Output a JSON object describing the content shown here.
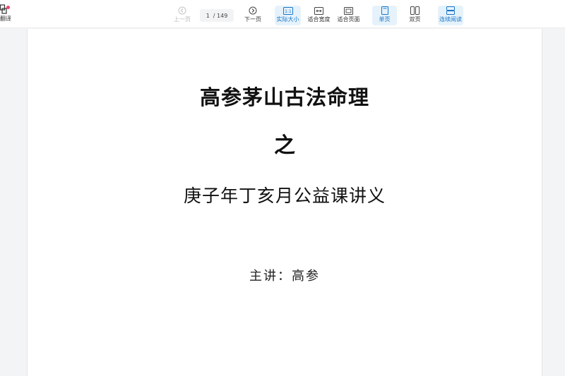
{
  "toolbar": {
    "translate_label": "翻译",
    "prev_label": "上一页",
    "next_label": "下一页",
    "current_page": "1",
    "total_pages": "/ 149",
    "actual_size_label": "实际大小",
    "fit_width_label": "适合宽度",
    "fit_page_label": "适合页面",
    "single_page_label": "单页",
    "double_page_label": "双页",
    "continuous_label": "连续阅读",
    "accent_color": "#1677c9",
    "active_bg": "#e6f2fb"
  },
  "document": {
    "title": "高参茅山古法命理",
    "connector": "之",
    "subtitle": "庚子年丁亥月公益课讲义",
    "speaker": "主讲：高参"
  }
}
